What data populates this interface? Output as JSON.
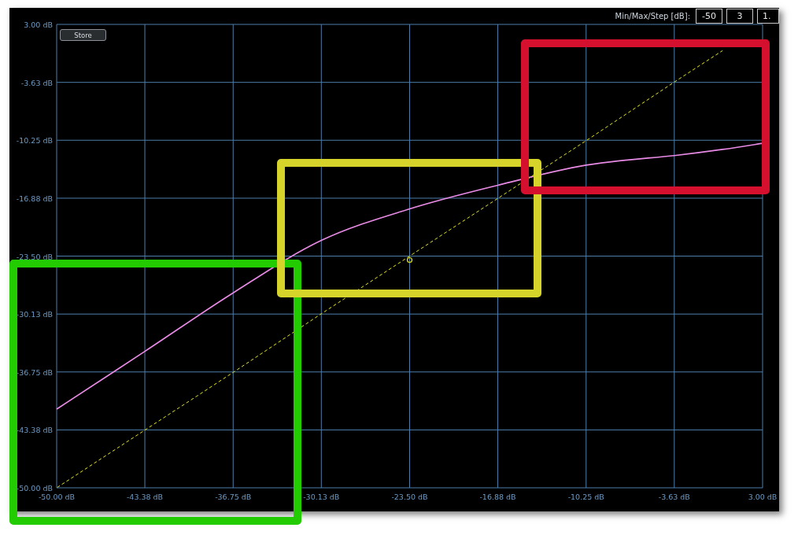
{
  "toolbar": {
    "label": "Min/Max/Step [dB]:",
    "fields": [
      {
        "value": "-50"
      },
      {
        "value": "3"
      },
      {
        "value": "1."
      }
    ]
  },
  "store_button": {
    "label": "Store"
  },
  "chart": {
    "chart_data": {
      "type": "line",
      "x": [
        -50,
        -43.38,
        -36.75,
        -30.13,
        -23.5,
        -16.88,
        -10.25,
        -3.63,
        0,
        3
      ],
      "series": [
        {
          "color": "#e98be6",
          "line_style": "solid",
          "values": [
            -41.0,
            -34.4,
            -27.7,
            -21.7,
            -18.1,
            -15.4,
            -13.1,
            -12.0,
            -11.3,
            -10.6
          ]
        },
        {
          "color": "#e6e61e",
          "line_style": "dashed",
          "values": [
            -50,
            -43.4,
            -36.8,
            -30.1,
            -23.5,
            -16.9,
            -10.3,
            -3.6,
            0,
            null
          ]
        }
      ],
      "grid": true,
      "xlim": [
        -50,
        3
      ],
      "ylim": [
        -50,
        3
      ],
      "xticks": [
        {
          "value": -50,
          "label": "-50.00 dB"
        },
        {
          "value": -43.38,
          "label": "-43.38 dB"
        },
        {
          "value": -36.75,
          "label": "-36.75 dB"
        },
        {
          "value": -30.13,
          "label": "-30.13 dB"
        },
        {
          "value": -23.5,
          "label": "-23.50 dB"
        },
        {
          "value": -16.88,
          "label": "-16.88 dB"
        },
        {
          "value": -10.25,
          "label": "-10.25 dB"
        },
        {
          "value": -3.63,
          "label": "-3.63 dB"
        },
        {
          "value": 3,
          "label": "3.00 dB"
        }
      ],
      "yticks": [
        {
          "value": 3,
          "label": "3.00 dB"
        },
        {
          "value": -3.63,
          "label": "-3.63 dB"
        },
        {
          "value": -10.25,
          "label": "-10.25 dB"
        },
        {
          "value": -16.88,
          "label": "-16.88 dB"
        },
        {
          "value": -23.5,
          "label": "-23.50 dB"
        },
        {
          "value": -30.13,
          "label": "-30.13 dB"
        },
        {
          "value": -36.75,
          "label": "-36.75 dB"
        },
        {
          "value": -43.38,
          "label": "-43.38 dB"
        },
        {
          "value": -50,
          "label": "-50.00 dB"
        }
      ]
    }
  },
  "highlights": [
    {
      "color": "#22cc00"
    },
    {
      "color": "#d6d42a"
    },
    {
      "color": "#d4102e"
    }
  ]
}
